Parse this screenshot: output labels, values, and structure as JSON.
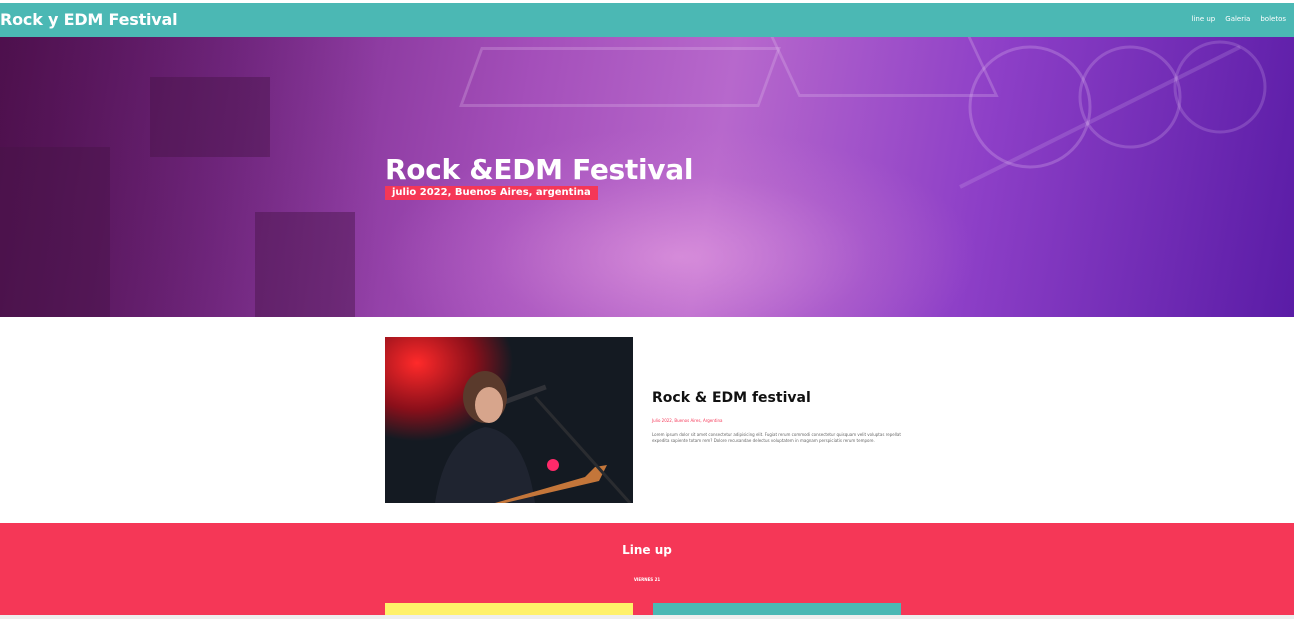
{
  "navbar": {
    "brand": "Rock y EDM Festival",
    "links": [
      "line up",
      "Galeria",
      "boletos"
    ]
  },
  "hero": {
    "title": "Rock &EDM Festival",
    "subtitle": "julio 2022, Buenos Aires, argentina"
  },
  "about": {
    "title": "Rock & EDM festival",
    "date": "Julio 2022, Buenos Aires, Argentina",
    "text": "Lorem ipsum dolor sit amet consectetur adipisicing elit. Fugiat rerum commodi consectetur quisquam velit voluptas repellat expedita sapiente totam rem? Dolore recusandae delectus voluptatem in magnam perspiciatis rerum tempore."
  },
  "lineup": {
    "title": "Line up",
    "day": "VIERNES 21"
  },
  "colors": {
    "teal": "#4bb8b4",
    "pink": "#f53757",
    "yellow": "#fff16a"
  }
}
